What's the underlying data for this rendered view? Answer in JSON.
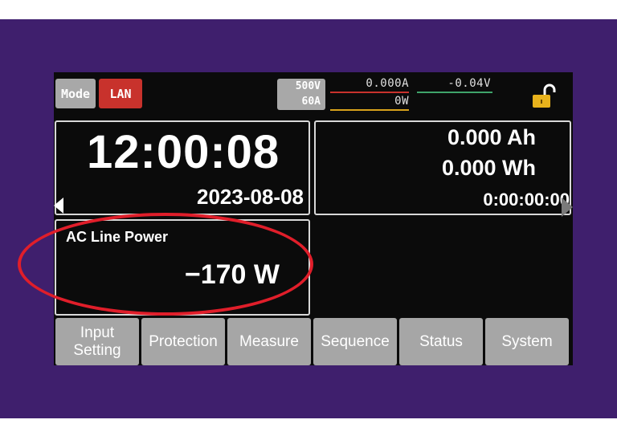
{
  "header": {
    "mode_label": "Mode",
    "lan_label": "LAN",
    "range_voltage": "500V",
    "range_current": "60A",
    "current_reading": "0.000A",
    "voltage_reading": "-0.04V",
    "power_reading": "0W",
    "lock_icon": "unlocked-padlock-icon"
  },
  "clock_panel": {
    "time": "12:00:08",
    "date": "2023-08-08"
  },
  "totals_panel": {
    "amp_hours": "0.000 Ah",
    "watt_hours": "0.000 Wh",
    "elapsed": "0:00:00:00"
  },
  "ac_panel": {
    "label": "AC Line Power",
    "value": "−170 W"
  },
  "tabs": [
    {
      "label": "Input\nSetting"
    },
    {
      "label": "Protection"
    },
    {
      "label": "Measure"
    },
    {
      "label": "Sequence"
    },
    {
      "label": "Status"
    },
    {
      "label": "System"
    }
  ],
  "colors": {
    "background_frame": "#3f1f6d",
    "lan_button": "#c8322c",
    "tab_button": "#a6a6a6",
    "annotation_ellipse": "#e01e2a",
    "current_line": "#c8322c",
    "voltage_line": "#3fa36a",
    "power_line": "#d8a21c"
  }
}
